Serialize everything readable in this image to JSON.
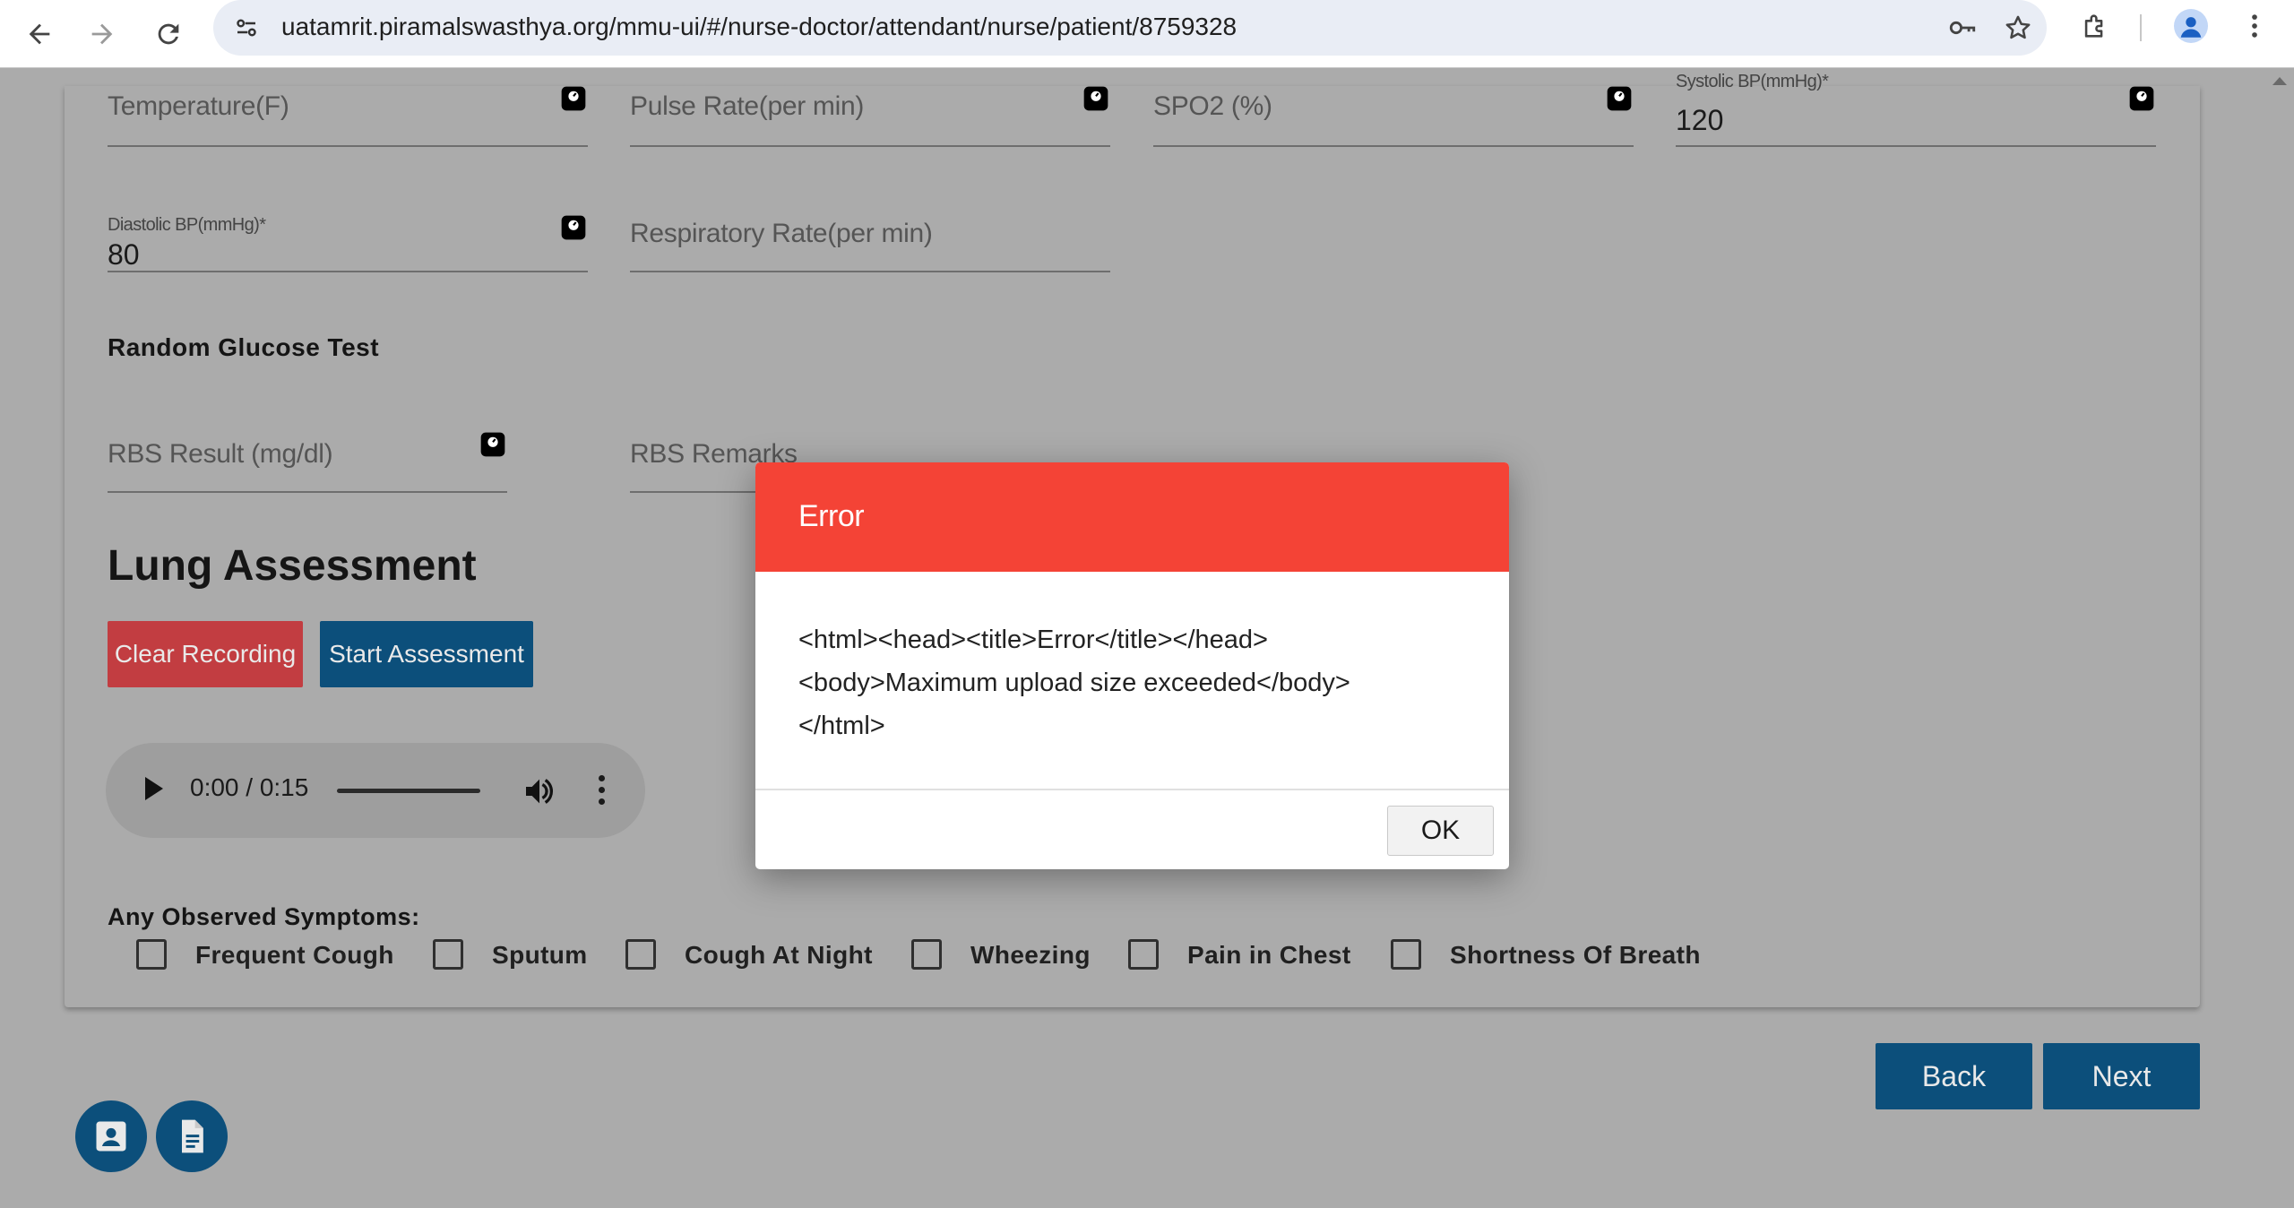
{
  "browser": {
    "url": "uatamrit.piramalswasthya.org/mmu-ui/#/nurse-doctor/attendant/nurse/patient/8759328",
    "icons": [
      "back-arrow-icon",
      "forward-arrow-icon",
      "reload-icon",
      "site-info-icon",
      "password-key-icon",
      "bookmark-star-icon",
      "extensions-icon",
      "profile-avatar-icon",
      "browser-menu-icon"
    ]
  },
  "vitals": {
    "temperature": {
      "label": "Temperature(F)"
    },
    "pulse_rate": {
      "label": "Pulse Rate(per min)"
    },
    "spo2": {
      "label": "SPO2 (%)"
    },
    "systolic_bp": {
      "label": "Systolic BP(mmHg)*",
      "value": "120"
    },
    "diastolic_bp": {
      "label": "Diastolic BP(mmHg)*",
      "value": "80"
    },
    "respiratory_rate": {
      "label": "Respiratory Rate(per min)"
    }
  },
  "glucose": {
    "section_label": "Random Glucose Test",
    "rbs_result": {
      "label": "RBS Result (mg/dl)"
    },
    "rbs_remarks": {
      "label": "RBS Remarks"
    }
  },
  "lung_assessment": {
    "title": "Lung Assessment",
    "clear_recording_label": "Clear Recording",
    "start_assessment_label": "Start Assessment",
    "audio_time": "0:00 / 0:15",
    "symptoms_label": "Any Observed Symptoms:",
    "symptoms": [
      "Frequent Cough",
      "Sputum",
      "Cough At Night",
      "Wheezing",
      "Pain in Chest",
      "Shortness Of Breath"
    ]
  },
  "footer": {
    "back_label": "Back",
    "next_label": "Next"
  },
  "dialog": {
    "title": "Error",
    "message_lines": [
      "<html><head><title>Error</title></head>",
      "<body>Maximum upload size exceeded</body>",
      "</html>"
    ],
    "ok_label": "OK"
  },
  "colors": {
    "overlay_gray": "#ababab",
    "error_header": "#f44336",
    "primary_blue": "#0c4f7b",
    "danger_red": "#c23d41"
  }
}
